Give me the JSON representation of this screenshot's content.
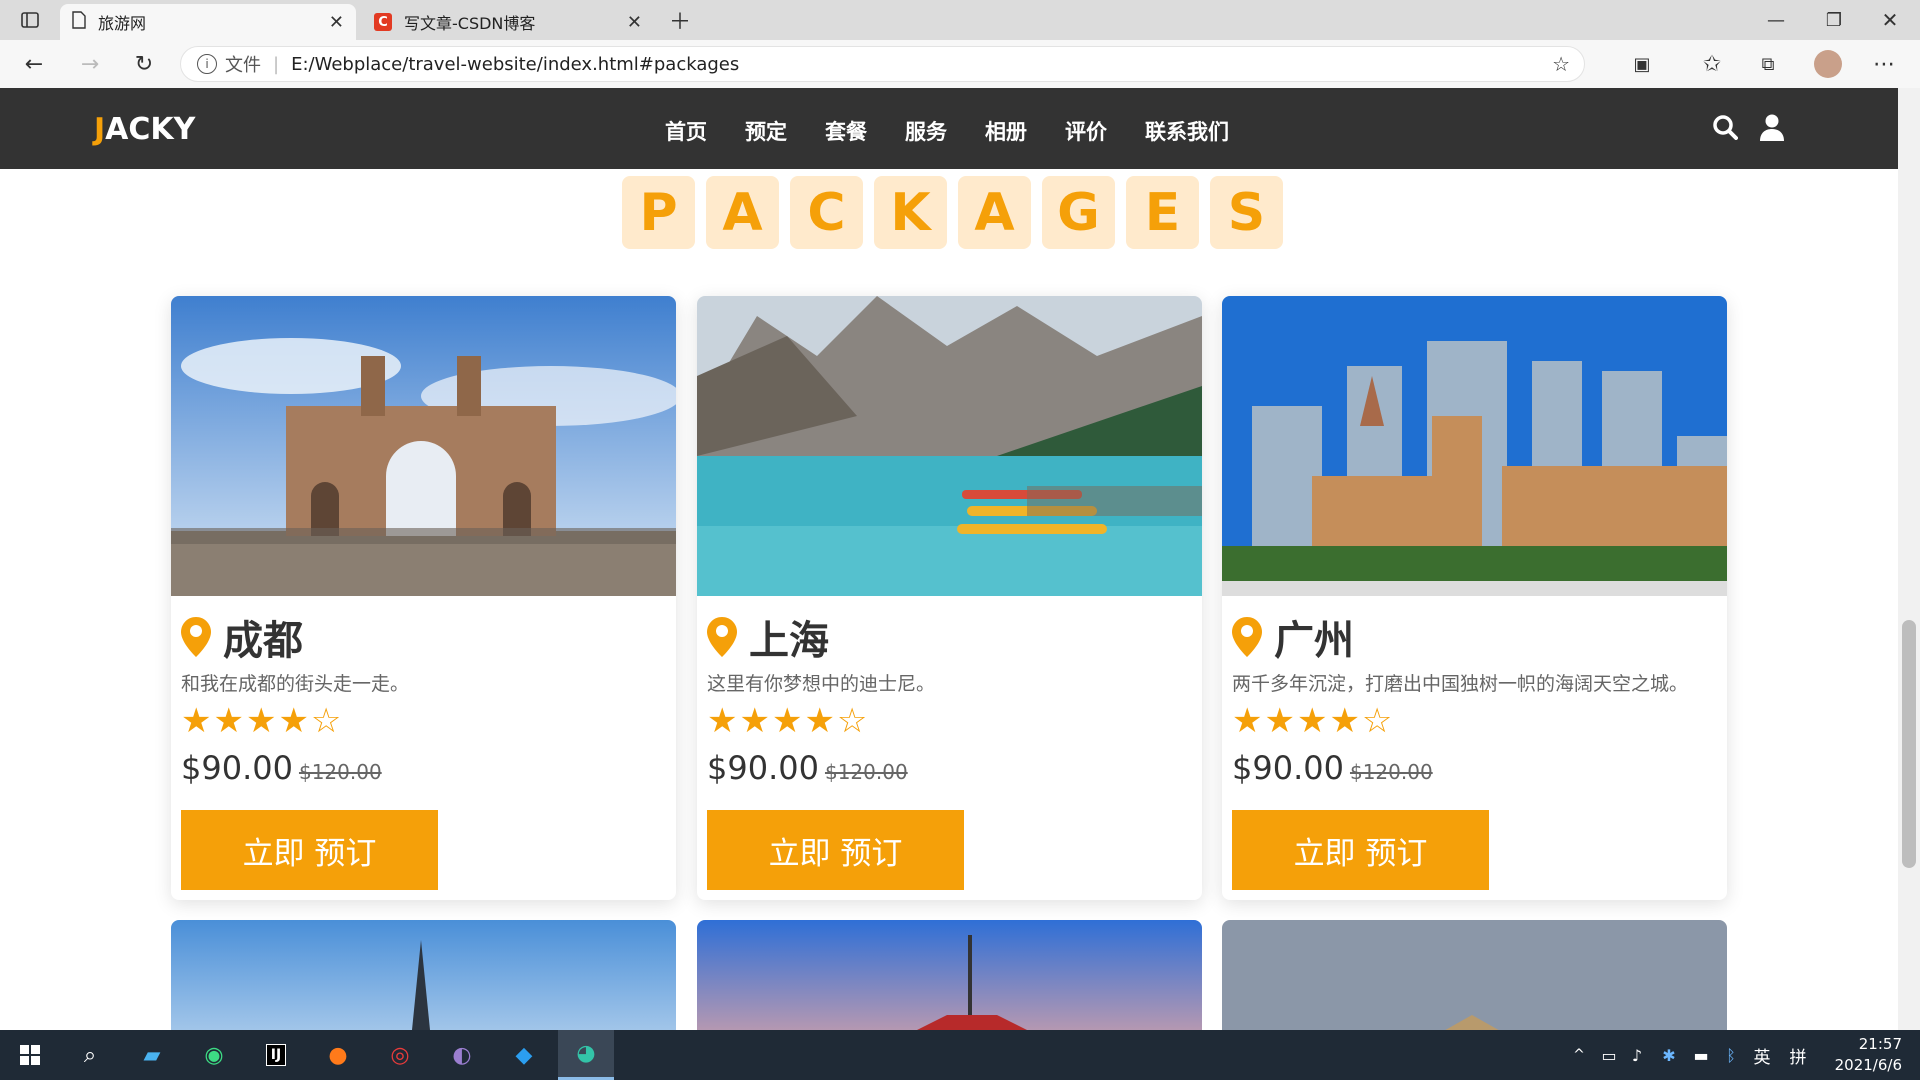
{
  "browser": {
    "tabs": [
      {
        "title": "旅游网",
        "active": true
      },
      {
        "title": "写文章-CSDN博客",
        "active": false
      }
    ],
    "address": {
      "info_label": "文件",
      "url": "E:/Webplace/travel-website/index.html#packages"
    }
  },
  "site": {
    "logo_first": "J",
    "logo_rest": "ACKY",
    "nav": [
      "首页",
      "预定",
      "套餐",
      "服务",
      "相册",
      "评价",
      "联系我们"
    ],
    "accent_color": "#f5a009"
  },
  "heading_letters": [
    "P",
    "A",
    "C",
    "K",
    "A",
    "G",
    "E",
    "S"
  ],
  "packages": [
    {
      "city": "成都",
      "desc": "和我在成都的街头走一走。",
      "rating": 4,
      "max_rating": 5,
      "price": "$90.00",
      "old_price": "$120.00",
      "button": "立即 预订"
    },
    {
      "city": "上海",
      "desc": "这里有你梦想中的迪士尼。",
      "rating": 4,
      "max_rating": 5,
      "price": "$90.00",
      "old_price": "$120.00",
      "button": "立即 预订"
    },
    {
      "city": "广州",
      "desc": "两千多年沉淀，打磨出中国独树一帜的海阔天空之城。",
      "rating": 4,
      "max_rating": 5,
      "price": "$90.00",
      "old_price": "$120.00",
      "button": "立即 预订"
    }
  ],
  "taskbar": {
    "time": "21:57",
    "date": "2021/6/6",
    "ime": "英",
    "ime2": "拼"
  }
}
